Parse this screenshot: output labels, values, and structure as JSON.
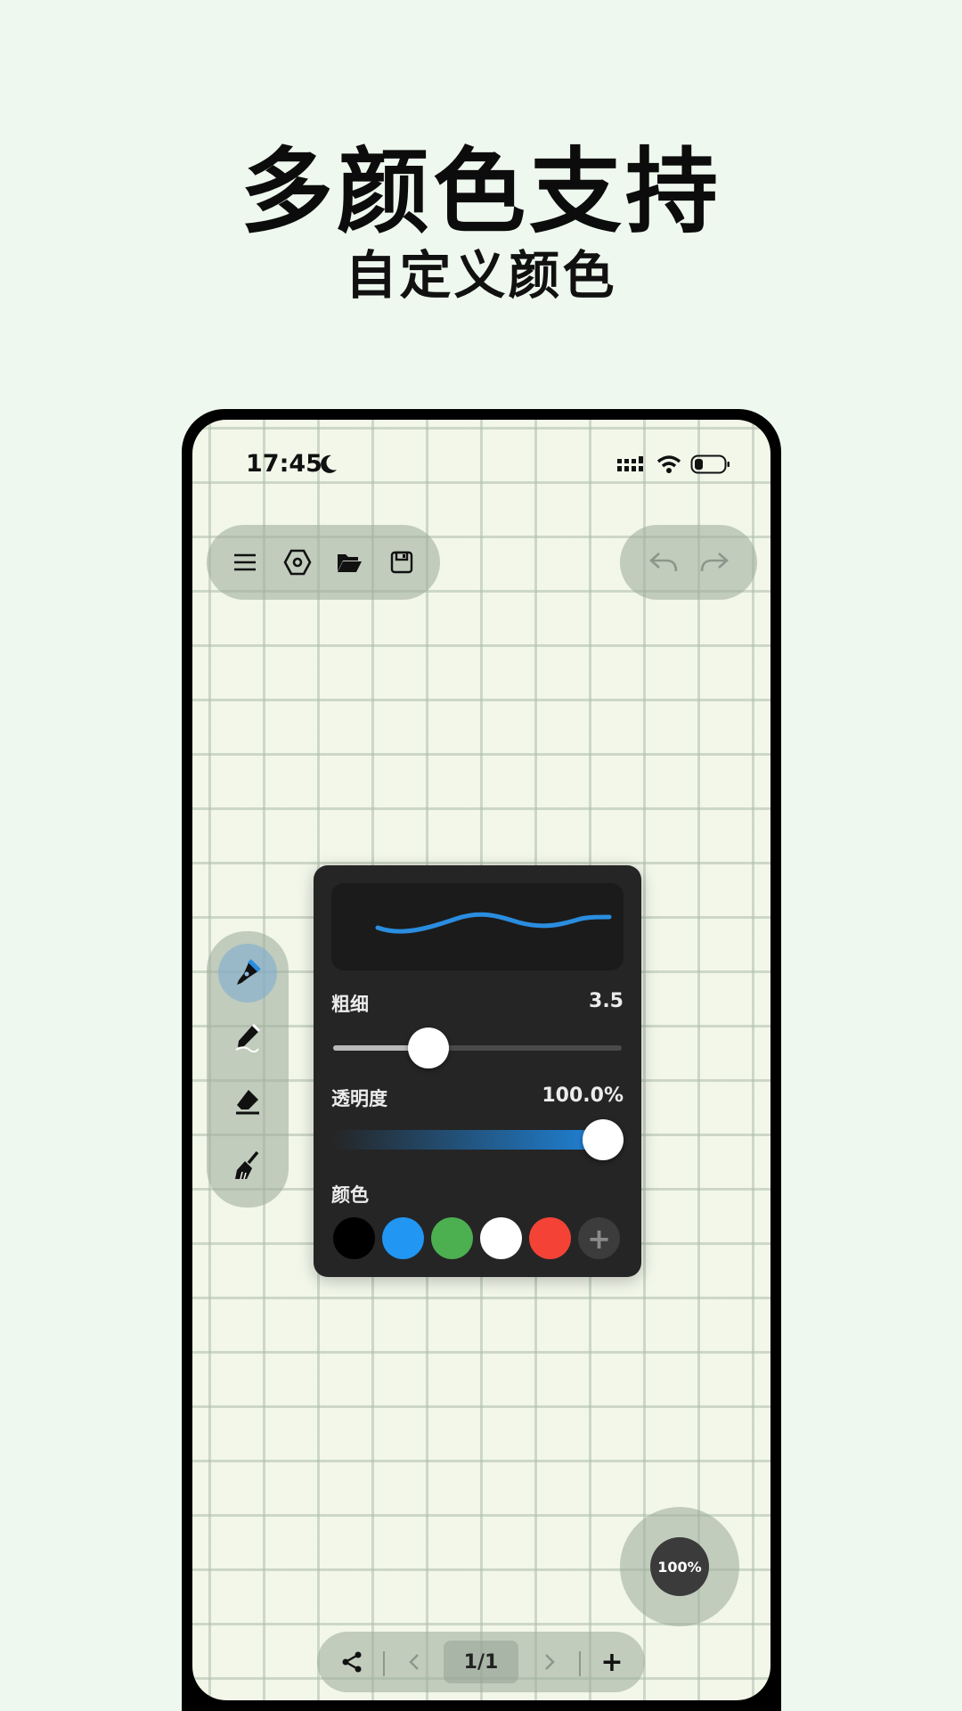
{
  "promo": {
    "headline": "多颜色支持",
    "subhead": "自定义颜色"
  },
  "status_bar": {
    "time": "17:45",
    "icons": [
      "moon-icon",
      "signal-icon",
      "wifi-icon",
      "battery-icon"
    ]
  },
  "top_toolbar": {
    "icons": [
      "menu-icon",
      "settings-hexagon-icon",
      "folder-open-icon",
      "save-icon"
    ]
  },
  "history_toolbar": {
    "icons": [
      "undo-icon",
      "redo-icon"
    ],
    "enabled": false
  },
  "tools": {
    "items": [
      "pen-tool-icon",
      "pencil-tool-icon",
      "eraser-tool-icon",
      "broom-clear-icon"
    ],
    "active": "pen-tool-icon"
  },
  "brush_panel": {
    "thickness_label": "粗细",
    "thickness_value": "3.5",
    "thickness_fraction": 0.3,
    "opacity_label": "透明度",
    "opacity_value": "100.0%",
    "opacity_fraction": 1.0,
    "color_label": "颜色",
    "preview_stroke_color": "#2a8de0",
    "swatches": [
      {
        "name": "black",
        "hex": "#000000"
      },
      {
        "name": "blue",
        "hex": "#2196f3"
      },
      {
        "name": "green",
        "hex": "#4caf50"
      },
      {
        "name": "white",
        "hex": "#ffffff"
      },
      {
        "name": "red",
        "hex": "#f44336"
      }
    ],
    "add_swatch_label": "+"
  },
  "zoom": {
    "label": "100%"
  },
  "bottom_bar": {
    "page_label": "1/1",
    "add_label": "+"
  }
}
